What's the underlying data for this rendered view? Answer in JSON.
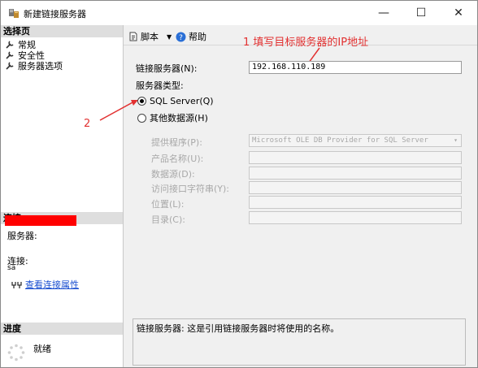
{
  "window": {
    "title": "新建链接服务器",
    "minimize": "—",
    "maximize": "☐",
    "close": "✕"
  },
  "left_panel": {
    "select_page_header": "选择页",
    "pages": [
      "常规",
      "安全性",
      "服务器选项"
    ],
    "connection_header": "连接",
    "server_label": "服务器:",
    "connect_label": "连接:",
    "connect_value": "sa",
    "view_props_link": "查看连接属性",
    "progress_header": "进度",
    "progress_status": "就绪"
  },
  "toolbar": {
    "script_label": "脚本",
    "help_label": "帮助"
  },
  "annotations": {
    "note1": "1 填写目标服务器的IP地址",
    "note2": "2"
  },
  "form": {
    "linked_server_label": "链接服务器(N):",
    "linked_server_value": "192.168.110.189",
    "server_type_label": "服务器类型:",
    "radio_sql": "SQL Server(Q)",
    "radio_other": "其他数据源(H)",
    "provider_label": "提供程序(P):",
    "provider_value": "Microsoft OLE DB Provider for SQL Server",
    "product_label": "产品名称(U):",
    "datasource_label": "数据源(D):",
    "provstring_label": "访问接口字符串(Y):",
    "location_label": "位置(L):",
    "catalog_label": "目录(C):"
  },
  "description": "链接服务器: 这是引用链接服务器时将使用的名称。",
  "colors": {
    "annotation": "#e23030",
    "redaction": "#ff0000",
    "link": "#1a4fd0"
  }
}
